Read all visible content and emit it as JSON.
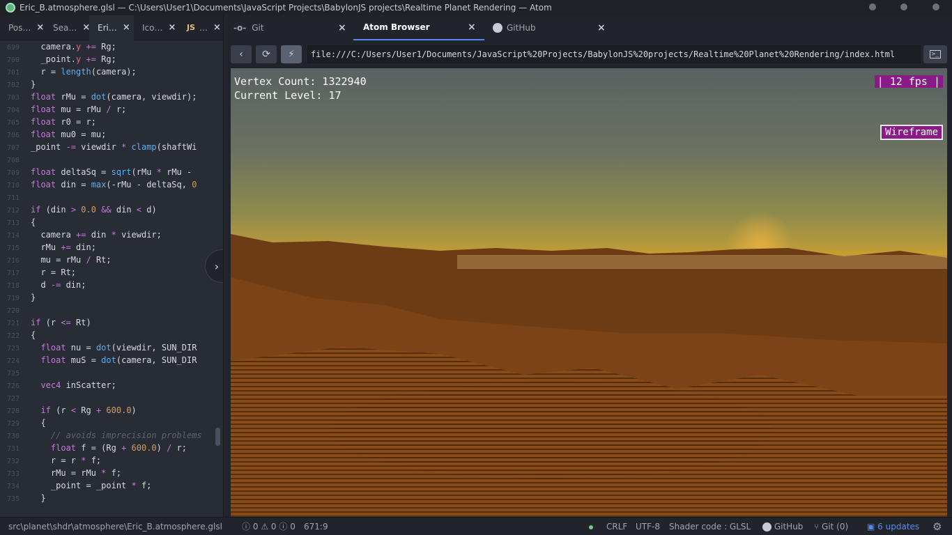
{
  "window": {
    "title": "Eric_B.atmosphere.glsl — C:\\Users\\User1\\Documents\\JavaScript Projects\\BabylonJS projects\\Realtime Planet Rendering — Atom"
  },
  "left_tabs": [
    {
      "label": "Pos…"
    },
    {
      "label": "Sea…"
    },
    {
      "label": "Eri…"
    },
    {
      "label": "Ico…"
    },
    {
      "label": "…",
      "badge": "JS"
    }
  ],
  "code_lines": [
    {
      "n": "699",
      "html": "  camera.<span class=\"prop\">y</span> <span class=\"kw\">+=</span> Rg;"
    },
    {
      "n": "700",
      "html": "  _point.<span class=\"prop\">y</span> <span class=\"kw\">+=</span> Rg;"
    },
    {
      "n": "701",
      "html": "  r = <span class=\"fn\">length</span>(camera);"
    },
    {
      "n": "702",
      "html": "}"
    },
    {
      "n": "703",
      "html": "<span class=\"kw\">float</span> rMu = <span class=\"fn\">dot</span>(camera, viewdir);"
    },
    {
      "n": "704",
      "html": "<span class=\"kw\">float</span> mu = rMu <span class=\"kw\">/</span> r;"
    },
    {
      "n": "705",
      "html": "<span class=\"kw\">float</span> r0 = r;"
    },
    {
      "n": "706",
      "html": "<span class=\"kw\">float</span> mu0 = mu;"
    },
    {
      "n": "707",
      "html": "_point <span class=\"kw\">-=</span> viewdir <span class=\"kw\">*</span> <span class=\"fn\">clamp</span>(shaftWi"
    },
    {
      "n": "708",
      "html": ""
    },
    {
      "n": "709",
      "html": "<span class=\"kw\">float</span> deltaSq = <span class=\"fn\">sqrt</span>(rMu <span class=\"kw\">*</span> rMu -"
    },
    {
      "n": "710",
      "html": "<span class=\"kw\">float</span> din = <span class=\"fn\">max</span>(-rMu - deltaSq, <span class=\"num\">0</span>"
    },
    {
      "n": "711",
      "html": ""
    },
    {
      "n": "712",
      "html": "<span class=\"kw\">if</span> (din <span class=\"kw\">&gt;</span> <span class=\"num\">0.0</span> <span class=\"kw\">&amp;&amp;</span> din <span class=\"kw\">&lt;</span> d)"
    },
    {
      "n": "713",
      "html": "{"
    },
    {
      "n": "714",
      "html": "  camera <span class=\"kw\">+=</span> din <span class=\"kw\">*</span> viewdir;"
    },
    {
      "n": "715",
      "html": "  rMu <span class=\"kw\">+=</span> din;"
    },
    {
      "n": "716",
      "html": "  mu = rMu <span class=\"kw\">/</span> Rt;"
    },
    {
      "n": "717",
      "html": "  r = Rt;"
    },
    {
      "n": "718",
      "html": "  d <span class=\"kw\">-=</span> din;"
    },
    {
      "n": "719",
      "html": "}"
    },
    {
      "n": "720",
      "html": ""
    },
    {
      "n": "721",
      "html": "<span class=\"kw\">if</span> (r <span class=\"kw\">&lt;=</span> Rt)"
    },
    {
      "n": "722",
      "html": "{"
    },
    {
      "n": "723",
      "html": "  <span class=\"kw\">float</span> nu = <span class=\"fn\">dot</span>(viewdir, SUN_DIR"
    },
    {
      "n": "724",
      "html": "  <span class=\"kw\">float</span> muS = <span class=\"fn\">dot</span>(camera, SUN_DIR"
    },
    {
      "n": "725",
      "html": ""
    },
    {
      "n": "726",
      "html": "  <span class=\"kw\">vec4</span> inScatter;"
    },
    {
      "n": "727",
      "html": ""
    },
    {
      "n": "728",
      "html": "  <span class=\"kw\">if</span> (r <span class=\"kw\">&lt;</span> Rg <span class=\"kw\">+</span> <span class=\"num\">600.0</span>)"
    },
    {
      "n": "729",
      "html": "  {"
    },
    {
      "n": "730",
      "html": "    <span class=\"cmt\">// avoids imprecision problems</span>"
    },
    {
      "n": "731",
      "html": "    <span class=\"kw\">float</span> f = (Rg <span class=\"kw\">+</span> <span class=\"num\">600.0</span>) <span class=\"kw\">/</span> r;"
    },
    {
      "n": "732",
      "html": "    r = r <span class=\"kw\">*</span> f;"
    },
    {
      "n": "733",
      "html": "    rMu = rMu <span class=\"kw\">*</span> f;"
    },
    {
      "n": "734",
      "html": "    _point = _point <span class=\"kw\">*</span> f;"
    },
    {
      "n": "735",
      "html": "  }"
    }
  ],
  "right_tabs": [
    {
      "label": "Git",
      "icon": "git-commit-icon"
    },
    {
      "label": "Atom Browser",
      "active": true
    },
    {
      "label": "GitHub",
      "icon": "github-octocat-icon"
    }
  ],
  "browser": {
    "back_icon": "chevron-left-icon",
    "refresh_icon": "refresh-icon",
    "live_icon": "lightning-icon",
    "url": "file:///C:/Users/User1/Documents/JavaScript%20Projects/BabylonJS%20projects/Realtime%20Planet%20Rendering/index.html",
    "devtools_icon": "terminal-icon"
  },
  "scene": {
    "vertex_count": "Vertex Count: 1322940",
    "current_level": "Current Level: 17",
    "fps": "| 12 fps |",
    "wireframe_button": "Wireframe"
  },
  "status": {
    "path": "src\\planet\\shdr\\atmosphere\\Eric_B.atmosphere.glsl",
    "errors": "0",
    "warnings": "0",
    "infos": "0",
    "cursor": "671:9",
    "line_ending": "CRLF",
    "encoding": "UTF-8",
    "grammar": "Shader code : GLSL",
    "github": "GitHub",
    "git": "Git (0)",
    "updates": "6 updates"
  },
  "colors": {
    "accent": "#568af2",
    "hud_magenta": "#8b1a89",
    "status_ok": "#73c990"
  }
}
